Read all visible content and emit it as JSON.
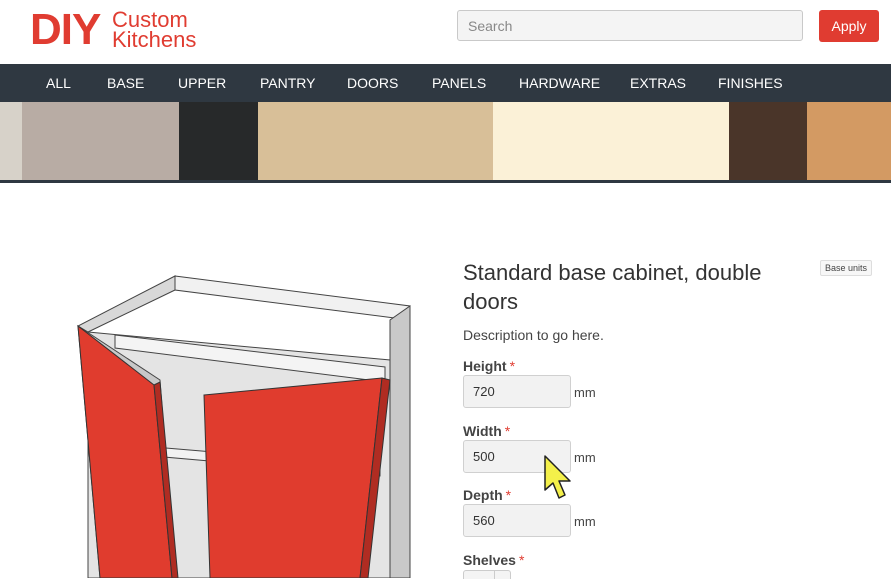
{
  "header": {
    "logo_main": "DIY",
    "logo_line1": "Custom",
    "logo_line2": "Kitchens",
    "search_placeholder": "Search",
    "apply_label": "Apply"
  },
  "nav": {
    "items": [
      "ALL",
      "BASE",
      "UPPER",
      "PANTRY",
      "DOORS",
      "PANELS",
      "HARDWARE",
      "EXTRAS",
      "FINISHES"
    ]
  },
  "swatches": {
    "colors": [
      "#d7d2c9",
      "#b8aca4",
      "#27292a",
      "#d8bf98",
      "#fbf1d7",
      "#4a3529",
      "#d39a63"
    ]
  },
  "product": {
    "title": "Standard base cabinet, double doors",
    "category_badge": "Base units",
    "description": "Description to go here.",
    "door_color": "#e03c2e",
    "fields": {
      "height_label": "Height",
      "height_value": "720",
      "width_label": "Width",
      "width_value": "500",
      "depth_label": "Depth",
      "depth_value": "560",
      "shelves_label": "Shelves",
      "required_mark": "*",
      "unit": "mm"
    }
  },
  "brand": {
    "accent": "#e03c31",
    "nav_bg": "#2f3841"
  }
}
